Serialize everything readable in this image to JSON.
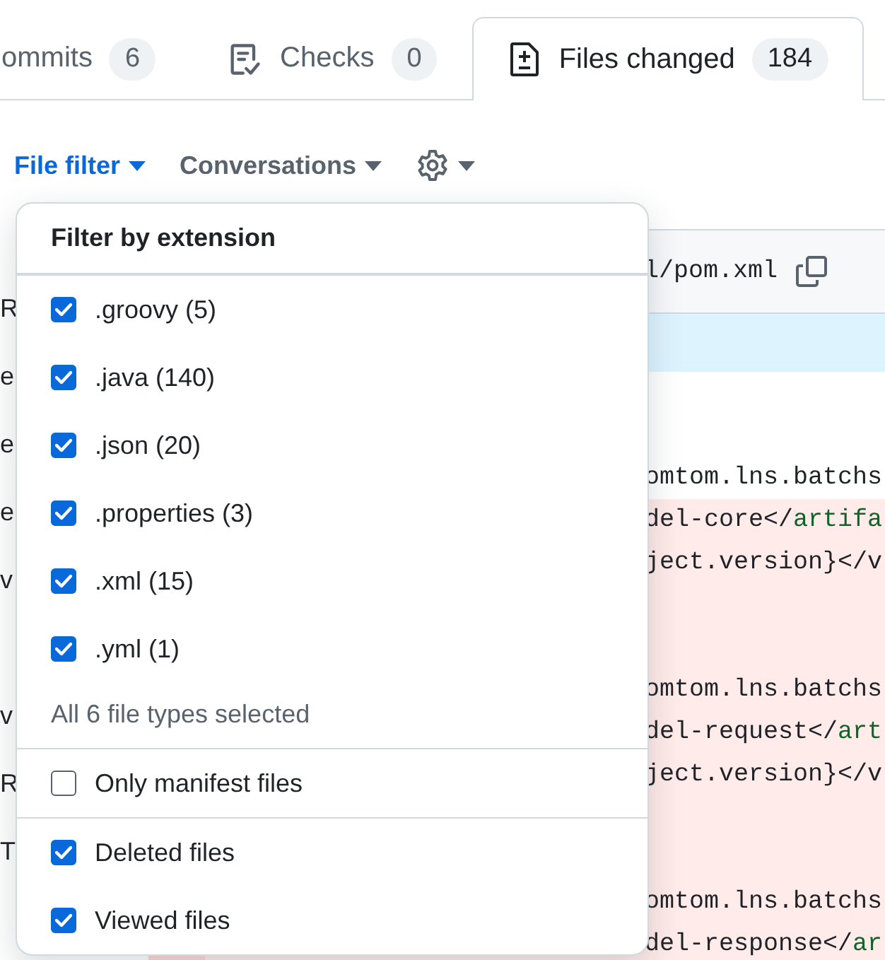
{
  "tabs": [
    {
      "label": "ommits",
      "count": "6",
      "kind": "plain",
      "selected": false
    },
    {
      "label": "Checks",
      "count": "0",
      "kind": "checks",
      "selected": false
    },
    {
      "label": "Files changed",
      "count": "184",
      "kind": "files",
      "selected": true
    }
  ],
  "toolbar": {
    "file_filter": "File filter",
    "conversations": "Conversations"
  },
  "sidebar": {
    "items": [
      "R",
      "e",
      "e",
      "e",
      "v",
      "v",
      "R",
      "T"
    ]
  },
  "diff": {
    "file_path": "l/pom.xml",
    "rows": [
      {
        "kind": "hunk"
      },
      {
        "kind": "context"
      },
      {
        "kind": "context"
      },
      {
        "kind": "context",
        "segments": [
          {
            "text": "omtom.lns.batchs",
            "kind": "plain"
          }
        ]
      },
      {
        "kind": "deleted",
        "segments": [
          {
            "text": "del-core</",
            "kind": "plain"
          },
          {
            "text": "artifa",
            "kind": "tag"
          }
        ]
      },
      {
        "kind": "deleted",
        "segments": [
          {
            "text": "ject.version}</v",
            "kind": "plain"
          }
        ]
      },
      {
        "kind": "deleted"
      },
      {
        "kind": "deleted"
      },
      {
        "kind": "deleted",
        "segments": [
          {
            "text": "omtom.lns.batchs",
            "kind": "plain"
          }
        ]
      },
      {
        "kind": "deleted",
        "segments": [
          {
            "text": "del-request</",
            "kind": "plain"
          },
          {
            "text": "art",
            "kind": "tag"
          }
        ]
      },
      {
        "kind": "deleted",
        "segments": [
          {
            "text": "ject.version}</v",
            "kind": "plain"
          }
        ]
      },
      {
        "kind": "deleted"
      },
      {
        "kind": "deleted"
      },
      {
        "kind": "deleted",
        "segments": [
          {
            "text": "omtom.lns.batchs",
            "kind": "plain"
          }
        ]
      },
      {
        "kind": "deleted",
        "segments": [
          {
            "text": "del-response</",
            "kind": "plain"
          },
          {
            "text": "ar",
            "kind": "tag"
          }
        ]
      }
    ]
  },
  "filter_menu": {
    "title": "Filter by extension",
    "sections": [
      {
        "items": [
          {
            "label": ".groovy (5)",
            "checked": true
          },
          {
            "label": ".java (140)",
            "checked": true
          },
          {
            "label": ".json (20)",
            "checked": true
          },
          {
            "label": ".properties (3)",
            "checked": true
          },
          {
            "label": ".xml (15)",
            "checked": true
          },
          {
            "label": ".yml (1)",
            "checked": true
          }
        ],
        "summary": "All 6 file types selected"
      },
      {
        "items": [
          {
            "label": "Only manifest files",
            "checked": false
          }
        ]
      },
      {
        "items": [
          {
            "label": "Deleted files",
            "checked": true
          },
          {
            "label": "Viewed files",
            "checked": true
          }
        ]
      }
    ]
  }
}
